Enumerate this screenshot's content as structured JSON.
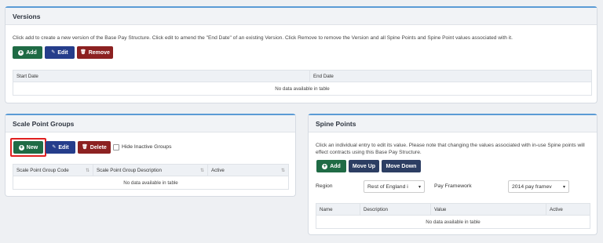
{
  "versions": {
    "title": "Versions",
    "description": "Click add to create a new version of the Base Pay Structure. Click edit to amend the \"End Date\" of an existing Version. Click Remove to remove the Version and all Spine Points and Spine Point values associated with it.",
    "add_label": "Add",
    "edit_label": "Edit",
    "remove_label": "Remove",
    "columns": [
      "Start Date",
      "End Date"
    ],
    "empty_text": "No data available in table"
  },
  "scale_point_groups": {
    "title": "Scale Point Groups",
    "new_label": "New",
    "edit_label": "Edit",
    "delete_label": "Delete",
    "hide_inactive_label": "Hide Inactive Groups",
    "columns": [
      "Scale Point Group Code",
      "Scale Point Group Description",
      "Active"
    ],
    "empty_text": "No data available in table"
  },
  "spine_points": {
    "title": "Spine Points",
    "description": "Click an individual entry to edit its value. Please note that changing the values associated with in-use Spine points will effect contracts using this Base Pay Structure.",
    "add_label": "Add",
    "move_up_label": "Move Up",
    "move_down_label": "Move Down",
    "region_label": "Region",
    "region_value": "Rest of England i",
    "pay_framework_label": "Pay Framework",
    "pay_framework_value": "2014 pay framev",
    "columns": [
      "Name",
      "Description",
      "Value",
      "Active"
    ],
    "empty_text": "No data available in table"
  },
  "colors": {
    "green": "#1f6b45",
    "blue": "#253d8b",
    "red": "#8c2121",
    "accent": "#5b9bd5",
    "highlight": "#e02020"
  }
}
